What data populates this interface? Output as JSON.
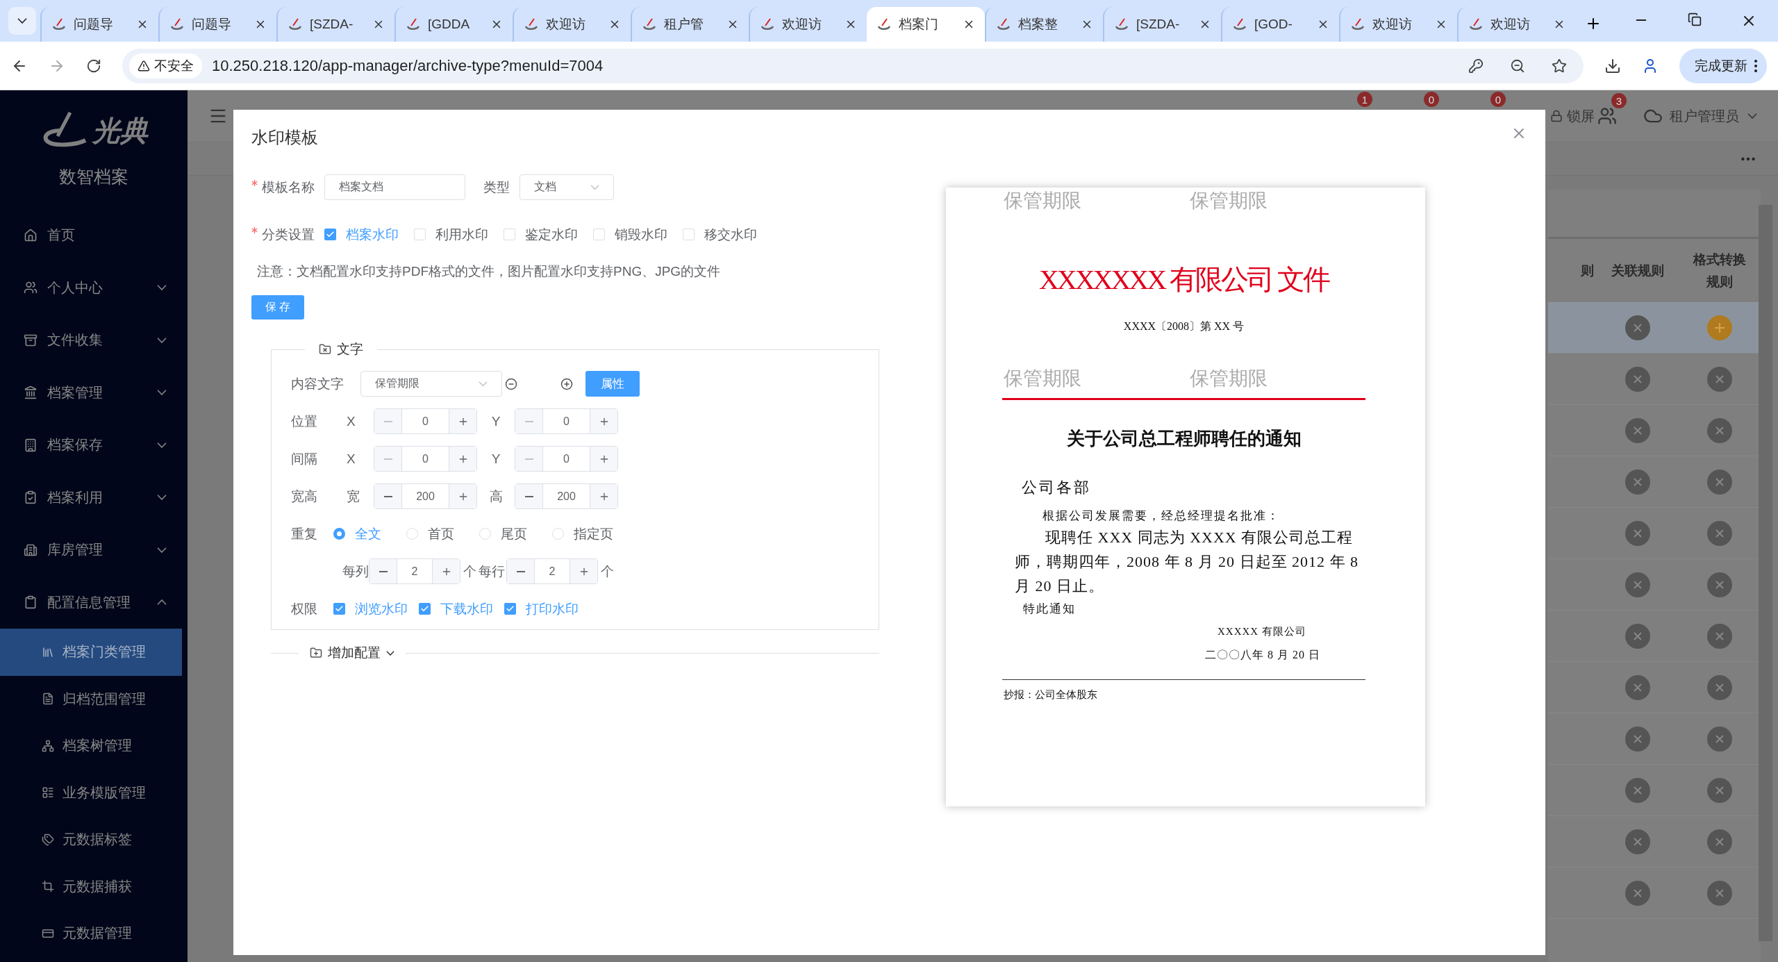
{
  "browser": {
    "tabs": [
      {
        "title": "问题导",
        "selected": false
      },
      {
        "title": "问题导",
        "selected": false
      },
      {
        "title": "[SZDA-",
        "selected": false
      },
      {
        "title": "[GDDA",
        "selected": false
      },
      {
        "title": "欢迎访",
        "selected": false
      },
      {
        "title": "租户管",
        "selected": false
      },
      {
        "title": "欢迎访",
        "selected": false
      },
      {
        "title": "档案门",
        "selected": true
      },
      {
        "title": "档案整",
        "selected": false
      },
      {
        "title": "[SZDA-",
        "selected": false
      },
      {
        "title": "[GOD-",
        "selected": false
      },
      {
        "title": "欢迎访",
        "selected": false
      },
      {
        "title": "欢迎访",
        "selected": false
      }
    ],
    "security_label": "不安全",
    "url": "10.250.218.120/app-manager/archive-type?menuId=7004",
    "update_button": "完成更新"
  },
  "header": {
    "badges": [
      "1",
      "0",
      "0"
    ],
    "lock_label": "锁屏",
    "user_badge": "3",
    "user_name": "租户管理员"
  },
  "sidebar": {
    "brand": "光典",
    "subtitle": "数智档案",
    "items": [
      {
        "label": "首页"
      },
      {
        "label": "个人中心",
        "expanded": false
      },
      {
        "label": "文件收集",
        "expanded": false
      },
      {
        "label": "档案管理",
        "expanded": false
      },
      {
        "label": "档案保存",
        "expanded": false
      },
      {
        "label": "档案利用",
        "expanded": false
      },
      {
        "label": "库房管理",
        "expanded": false
      },
      {
        "label": "配置信息管理",
        "expanded": true,
        "children": [
          {
            "label": "档案门类管理",
            "selected": true
          },
          {
            "label": "归档范围管理",
            "selected": false
          },
          {
            "label": "档案树管理",
            "selected": false
          },
          {
            "label": "业务模版管理",
            "selected": false
          },
          {
            "label": "元数据标签",
            "selected": false
          },
          {
            "label": "元数据捕获",
            "selected": false
          },
          {
            "label": "元数据管理",
            "selected": false
          }
        ]
      }
    ]
  },
  "table": {
    "columns": [
      "则",
      "关联规则",
      "格式转换规则"
    ],
    "rows": [
      {
        "selected": true,
        "cells": [
          {
            "kind": "remove"
          },
          {
            "kind": "add"
          }
        ]
      },
      {
        "selected": false,
        "cells": [
          {
            "kind": "remove"
          },
          {
            "kind": "remove"
          }
        ]
      },
      {
        "selected": false,
        "cells": [
          {
            "kind": "remove"
          },
          {
            "kind": "remove"
          }
        ]
      },
      {
        "selected": false,
        "cells": [
          {
            "kind": "remove"
          },
          {
            "kind": "remove"
          }
        ]
      },
      {
        "selected": false,
        "cells": [
          {
            "kind": "remove"
          },
          {
            "kind": "remove"
          }
        ]
      },
      {
        "selected": false,
        "cells": [
          {
            "kind": "remove"
          },
          {
            "kind": "remove"
          }
        ]
      },
      {
        "selected": false,
        "cells": [
          {
            "kind": "remove"
          },
          {
            "kind": "remove"
          }
        ]
      },
      {
        "selected": false,
        "cells": [
          {
            "kind": "remove"
          },
          {
            "kind": "remove"
          }
        ]
      },
      {
        "selected": false,
        "cells": [
          {
            "kind": "remove"
          },
          {
            "kind": "remove"
          }
        ]
      },
      {
        "selected": false,
        "cells": [
          {
            "kind": "remove"
          },
          {
            "kind": "remove"
          }
        ]
      },
      {
        "selected": false,
        "cells": [
          {
            "kind": "remove"
          },
          {
            "kind": "remove"
          }
        ]
      },
      {
        "selected": false,
        "cells": [
          {
            "kind": "remove"
          },
          {
            "kind": "remove"
          }
        ]
      }
    ]
  },
  "modal": {
    "title": "水印模板",
    "name_field": {
      "label": "模板名称",
      "required": true,
      "value": "档案文档"
    },
    "type_field": {
      "label": "类型",
      "value": "文档"
    },
    "category": {
      "label": "分类设置",
      "required": true,
      "options": [
        {
          "label": "档案水印",
          "checked": true
        },
        {
          "label": "利用水印",
          "checked": false
        },
        {
          "label": "鉴定水印",
          "checked": false
        },
        {
          "label": "销毁水印",
          "checked": false
        },
        {
          "label": "移交水印",
          "checked": false
        }
      ]
    },
    "note": "注意：文档配置水印支持PDF格式的文件，图片配置水印支持PNG、JPG的文件",
    "save_button": "保 存",
    "text_section": {
      "legend": "文字",
      "content": {
        "label": "内容文字",
        "value": "保管期限",
        "button": "属性"
      },
      "position": {
        "label": "位置",
        "a_label": "X",
        "a": "0",
        "b_label": "Y",
        "b": "0"
      },
      "spacing": {
        "label": "间隔",
        "a_label": "X",
        "a": "0",
        "b_label": "Y",
        "b": "0"
      },
      "size": {
        "label": "宽高",
        "a_label": "宽",
        "a": "200",
        "b_label": "高",
        "b": "200"
      },
      "repeat": {
        "label": "重复",
        "options": [
          {
            "label": "全文",
            "selected": true
          },
          {
            "label": "首页",
            "selected": false
          },
          {
            "label": "尾页",
            "selected": false
          },
          {
            "label": "指定页",
            "selected": false
          }
        ]
      },
      "per_column": {
        "label": "每列",
        "value": "2",
        "unit": "个"
      },
      "per_row": {
        "label": "每行",
        "value": "2",
        "unit": "个"
      },
      "permissions": {
        "label": "权限",
        "options": [
          {
            "label": "浏览水印",
            "checked": true
          },
          {
            "label": "下载水印",
            "checked": true
          },
          {
            "label": "打印水印",
            "checked": true
          }
        ]
      }
    },
    "add_config": "增加配置",
    "preview": {
      "watermarks": [
        "保管期限",
        "保管期限",
        "保管期限",
        "保管期限"
      ],
      "red_title": "XXXXXXX 有限公司 文件",
      "doc_number": "XXXX〔2008〕第 XX 号",
      "heading": "关于公司总工程师聘任的通知",
      "salutation": "公司各部",
      "intro": "根据公司发展需要，经总经理提名批准：",
      "body": "现聘任 XXX 同志为 XXXX 有限公司总工程师，聘期四年，2008 年 8 月 20 日起至 2012 年 8 月 20 日止。",
      "closing": "特此通知",
      "signature": "XXXXX 有限公司",
      "date": "二〇〇八年 8 月 20 日",
      "cc": "抄报：公司全体股东"
    }
  }
}
